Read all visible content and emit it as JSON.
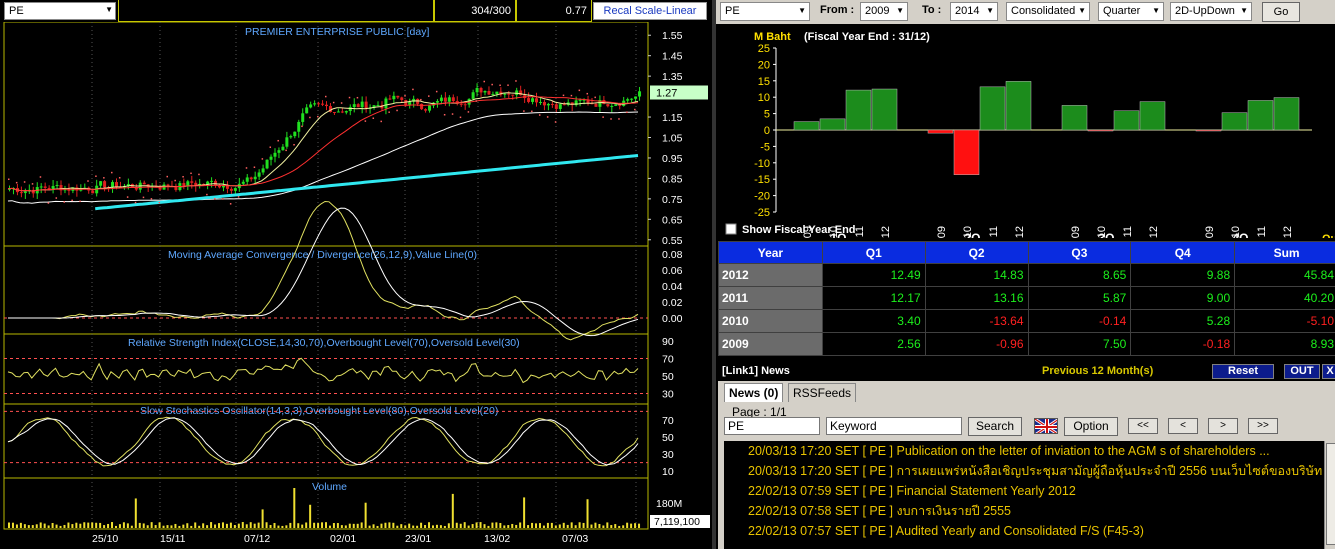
{
  "left": {
    "symbol": "PE",
    "count": "304/300",
    "last_value": "0.77",
    "recal_label": "Recal Scale-Linear",
    "price_panel": {
      "title": "PREMIER ENTERPRISE PUBLIC [day]",
      "y_ticks": [
        "1.55",
        "1.45",
        "1.35",
        "1.27",
        "1.15",
        "1.05",
        "0.95",
        "0.85",
        "0.75",
        "0.65",
        "0.55"
      ],
      "current_price": "1.27"
    },
    "macd_panel": {
      "title": "Moving Average Convergence / Divergence(26,12,9),Value Line(0)",
      "y_ticks": [
        "0.08",
        "0.06",
        "0.04",
        "0.02",
        "0.00"
      ]
    },
    "rsi_panel": {
      "title": "Relative Strength Index(CLOSE,14,30,70),Overbought Level(70),Oversold Level(30)",
      "y_ticks": [
        "90",
        "70",
        "50",
        "30"
      ]
    },
    "stoch_panel": {
      "title": "Slow  Stochastics Oscillator(14,3,3),Overbought Level(80),Oversold Level(20)",
      "y_ticks": [
        "70",
        "50",
        "30",
        "10"
      ]
    },
    "volume_panel": {
      "title": "Volume",
      "y_ticks": [
        "180M"
      ],
      "current_volume": "7,119,100"
    },
    "x_dates": [
      "25/10",
      "15/11",
      "07/12",
      "02/01",
      "23/01",
      "13/02",
      "07/03"
    ]
  },
  "right": {
    "symbol": "PE",
    "from_label": "From :",
    "from_value": "2009",
    "to_label": "To :",
    "to_value": "2014",
    "consolidated": "Consolidated",
    "period": "Quarter",
    "mode": "2D-UpDown",
    "go_label": "Go",
    "fin_chart": {
      "unit": "M Baht",
      "title": "(Fiscal Year End : 31/12)",
      "show_fy_label": "Show Fiscal Year End",
      "quadrant_label": "Quadrant",
      "y_ticks": [
        "25",
        "20",
        "15",
        "10",
        "5",
        "0",
        "-5",
        "-10",
        "-15",
        "-20",
        "-25"
      ],
      "groups": [
        "1Q",
        "2Q",
        "3Q",
        "4Q"
      ],
      "bar_labels": [
        "09",
        "10",
        "11",
        "12"
      ]
    },
    "table": {
      "headers": [
        "Year",
        "Q1",
        "Q2",
        "Q3",
        "Q4",
        "Sum"
      ],
      "rows": [
        {
          "year": "2012",
          "q1": "12.49",
          "q2": "14.83",
          "q3": "8.65",
          "q4": "9.88",
          "sum": "45.84"
        },
        {
          "year": "2011",
          "q1": "12.17",
          "q2": "13.16",
          "q3": "5.87",
          "q4": "9.00",
          "sum": "40.20"
        },
        {
          "year": "2010",
          "q1": "3.40",
          "q2": "-13.64",
          "q3": "-0.14",
          "q4": "5.28",
          "sum": "-5.10"
        },
        {
          "year": "2009",
          "q1": "2.56",
          "q2": "-0.96",
          "q3": "7.50",
          "q4": "-0.18",
          "sum": "8.93"
        }
      ]
    },
    "news": {
      "title": "[Link1] News",
      "previous_label": "Previous 12 Month(s)",
      "reset_label": "Reset",
      "out_label": "OUT",
      "close_label": "X",
      "tab_news": "News (0)",
      "tab_rss": "RSSFeeds",
      "page_label": "Page : 1/1",
      "symbol_input": "PE",
      "keyword_placeholder": "Keyword",
      "search_label": "Search",
      "option_label": "Option",
      "nav": [
        "<<",
        "<",
        ">",
        ">>"
      ],
      "items": [
        "20/03/13 17:20  SET  [ PE ]  Publication on the letter of inviation to the AGM s of shareholders ...",
        "20/03/13 17:20  SET  [ PE ]  การเผยแพร่หนังสือเชิญประชุมสามัญผู้ถือหุ้นประจำปี 2556 บนเว็บไซต์ของบริษัท",
        "22/02/13 07:59  SET  [ PE ]  Financial Statement Yearly 2012",
        "22/02/13 07:58  SET  [ PE ]  งบการเงินรายปี 2555",
        "22/02/13 07:57  SET  [ PE ]  Audited Yearly and Consolidated F/S (F45-3)"
      ]
    }
  },
  "chart_data": [
    {
      "type": "bar",
      "title": "(Fiscal Year End : 31/12)",
      "ylabel": "M Baht",
      "ylim": [
        -25,
        25
      ],
      "groups": [
        "1Q",
        "2Q",
        "3Q",
        "4Q"
      ],
      "categories": [
        "09",
        "10",
        "11",
        "12"
      ],
      "series": [
        {
          "name": "1Q",
          "values": [
            2.56,
            3.4,
            12.17,
            12.49
          ]
        },
        {
          "name": "2Q",
          "values": [
            -0.96,
            -13.64,
            13.16,
            14.83
          ]
        },
        {
          "name": "3Q",
          "values": [
            7.5,
            -0.14,
            5.87,
            8.65
          ]
        },
        {
          "name": "4Q",
          "values": [
            -0.18,
            5.28,
            9.0,
            9.88
          ]
        }
      ],
      "colors": {
        "positive": "#1c8c1c",
        "negative": "#ff1010"
      }
    }
  ]
}
